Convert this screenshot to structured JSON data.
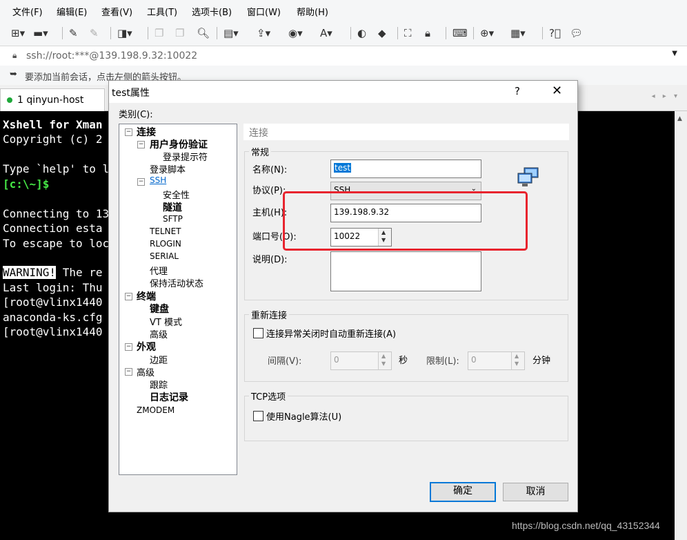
{
  "menu": [
    "文件(F)",
    "编辑(E)",
    "查看(V)",
    "工具(T)",
    "选项卡(B)",
    "窗口(W)",
    "帮助(H)"
  ],
  "address": {
    "text": "ssh://root:***@139.198.9.32:10022"
  },
  "hint": {
    "text": "要添加当前会话，点击左侧的箭头按钮。"
  },
  "tabs": [
    {
      "label": "1 qinyun-host",
      "status_color": "#1fa83a"
    }
  ],
  "terminal": {
    "lines": [
      "Xshell for Xman",
      "Copyright (c) 2",
      "",
      "Type `help' to l",
      "[c:\\~]$",
      "",
      "Connecting to 13",
      "Connection esta",
      "To escape to loc",
      "",
      "WARNING! The re",
      "Last login: Thu",
      "[root@vlinx1440",
      "anaconda-ks.cfg",
      "[root@vlinx1440"
    ]
  },
  "dialog": {
    "title": "test属性",
    "help": "?",
    "close": "✕",
    "category_label": "类别(C):",
    "tree": {
      "connection": "连接",
      "auth": "用户身份验证",
      "login_prompt": "登录提示符",
      "login_script": "登录脚本",
      "ssh": "SSH",
      "security": "安全性",
      "tunnel": "隧道",
      "sftp": "SFTP",
      "telnet": "TELNET",
      "rlogin": "RLOGIN",
      "serial": "SERIAL",
      "proxy": "代理",
      "keepalive": "保持活动状态",
      "terminal": "终端",
      "keyboard": "键盘",
      "vt_mode": "VT 模式",
      "advanced": "高级",
      "appearance": "外观",
      "margin": "边距",
      "advanced2": "高级",
      "trace": "跟踪",
      "logging": "日志记录",
      "zmodem": "ZMODEM"
    },
    "section_header": "连接",
    "general": {
      "title": "常规",
      "name_label": "名称(N):",
      "name_value": "test",
      "protocol_label": "协议(P):",
      "protocol_value": "SSH",
      "host_label": "主机(H):",
      "host_value": "139.198.9.32",
      "port_label": "端口号(O):",
      "port_value": "10022",
      "desc_label": "说明(D):",
      "desc_value": ""
    },
    "reconnect": {
      "title": "重新连接",
      "checkbox_label": "连接异常关闭时自动重新连接(A)",
      "checked": false,
      "interval_label": "间隔(V):",
      "interval_value": "0",
      "interval_unit": "秒",
      "limit_label": "限制(L):",
      "limit_value": "0",
      "limit_unit": "分钟"
    },
    "tcp": {
      "title": "TCP选项",
      "checkbox_label": "使用Nagle算法(U)",
      "checked": false
    },
    "ok": "确定",
    "cancel": "取消"
  },
  "watermark": "https://blog.csdn.net/qq_43152344",
  "colors": {
    "annotation_red": "#e8242e",
    "accent": "#0078d7",
    "terminal_bg": "#000000"
  }
}
